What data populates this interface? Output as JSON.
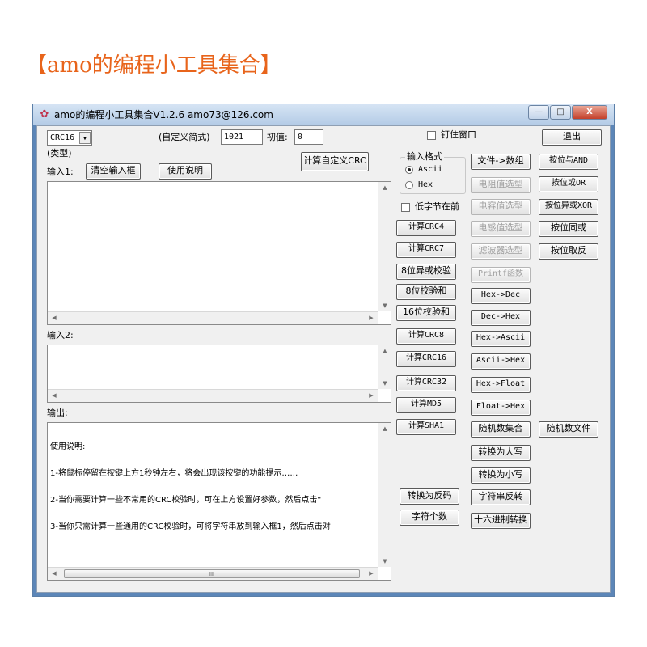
{
  "headline": "【amo的编程小工具集合】",
  "window": {
    "title": "amo的编程小工具集合V1.2.6 amo73@126.com",
    "minimize": "—",
    "maximize": "□",
    "close": "X"
  },
  "top": {
    "crc_type_value": "CRC16",
    "type_label": "(类型)",
    "custom_label": "(自定义简式)",
    "custom_value": "1021",
    "init_label": "初值:",
    "init_value": "0",
    "pin_label": "钉住窗口",
    "exit_label": "退出",
    "calc_custom_label": "计算自定义CRC"
  },
  "input1": {
    "label": "输入1:",
    "clear_label": "清空输入框",
    "help_label": "使用说明"
  },
  "input2": {
    "label": "输入2:"
  },
  "output": {
    "label": "输出:",
    "lines": [
      "使用说明:",
      "1-将鼠标停留在按键上方1秒钟左右，将会出现该按键的功能提示……",
      "2-当你需要计算一些不常用的CRC校验时，可在上方设置好参数，然后点击“",
      "3-当你只需计算一些通用的CRC校验时，可将字符串放到输入框1，然后点击对"
    ]
  },
  "format": {
    "legend": "输入格式",
    "ascii": "Ascii",
    "hex": "Hex",
    "low_byte_first": "低字节在前"
  },
  "col1": {
    "crc4": "计算CRC4",
    "crc7": "计算CRC7",
    "xor8": "8位异或校验",
    "sum8": "8位校验和",
    "sum16": "16位校验和",
    "crc8": "计算CRC8",
    "crc16": "计算CRC16",
    "crc32": "计算CRC32",
    "md5": "计算MD5",
    "sha1": "计算SHA1",
    "reverse_code": "转换为反码",
    "char_count": "字符个数"
  },
  "col2": {
    "file_to_array": "文件->数组",
    "resistor": "电阻值选型",
    "capacitor": "电容值选型",
    "inductor": "电感值选型",
    "filter": "滤波器选型",
    "printf": "Printf函数",
    "hex_dec": "Hex->Dec",
    "dec_hex": "Dec->Hex",
    "hex_ascii": "Hex->Ascii",
    "ascii_hex": "Ascii->Hex",
    "hex_float": "Hex->Float",
    "float_hex": "Float->Hex",
    "random_set": "随机数集合",
    "to_upper": "转换为大写",
    "to_lower": "转换为小写",
    "str_reverse": "字符串反转",
    "hex_convert": "十六进制转换"
  },
  "col3": {
    "and": "按位与AND",
    "or": "按位或OR",
    "xor": "按位异或XOR",
    "xnor": "按位同或",
    "not": "按位取反",
    "random_file": "随机数文件"
  },
  "scroll": {
    "up": "▲",
    "down": "▼",
    "left": "◀",
    "right": "▶",
    "thumb": "III"
  }
}
